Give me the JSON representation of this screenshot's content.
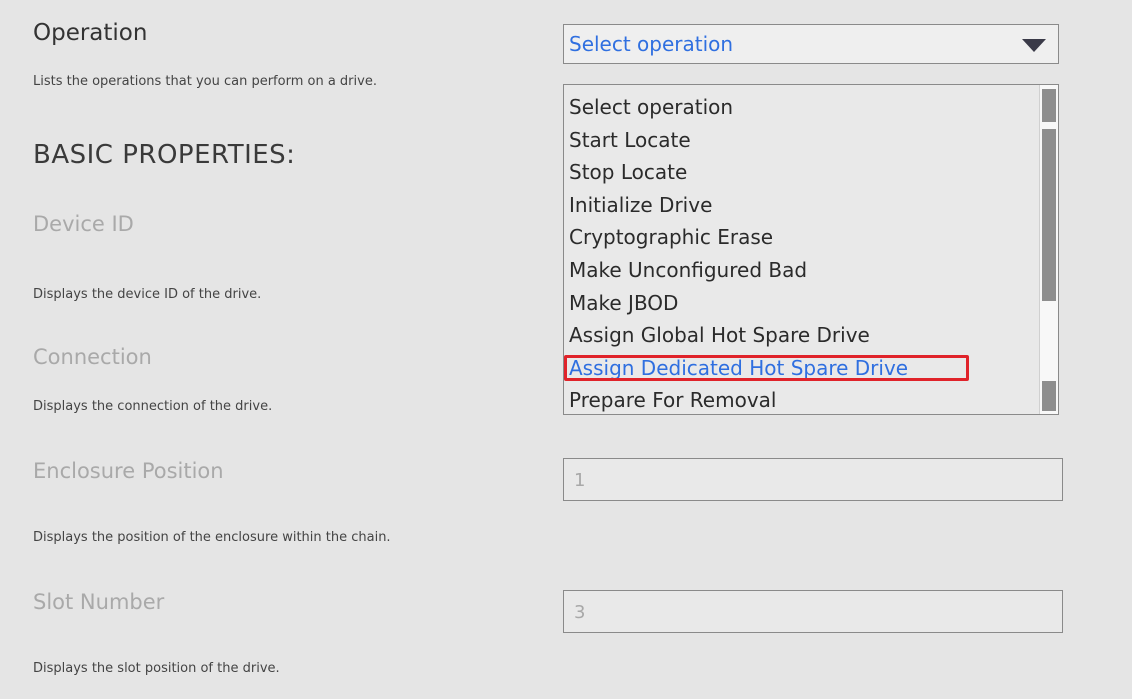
{
  "operation": {
    "label": "Operation",
    "description": "Lists the operations that you can perform on a drive.",
    "select_value": "Select operation",
    "options": [
      "Select operation",
      "Start Locate",
      "Stop Locate",
      "Initialize Drive",
      "Cryptographic Erase",
      "Make Unconfigured Bad",
      "Make JBOD",
      "Assign Global Hot Spare Drive",
      "Assign Dedicated Hot Spare Drive",
      "Prepare For Removal"
    ],
    "highlighted_option": "Assign Dedicated Hot Spare Drive"
  },
  "basic_properties": {
    "heading": "BASIC PROPERTIES:",
    "device_id": {
      "label": "Device ID",
      "description": "Displays the device ID of the drive."
    },
    "connection": {
      "label": "Connection",
      "description": "Displays the connection of the drive."
    },
    "enclosure_position": {
      "label": "Enclosure Position",
      "value": "1",
      "description": "Displays the position of the enclosure within the chain."
    },
    "slot_number": {
      "label": "Slot Number",
      "value": "3",
      "description": "Displays the slot position of the drive."
    }
  },
  "colors": {
    "accent": "#2f6fe0",
    "highlight_border": "#e0232a"
  }
}
